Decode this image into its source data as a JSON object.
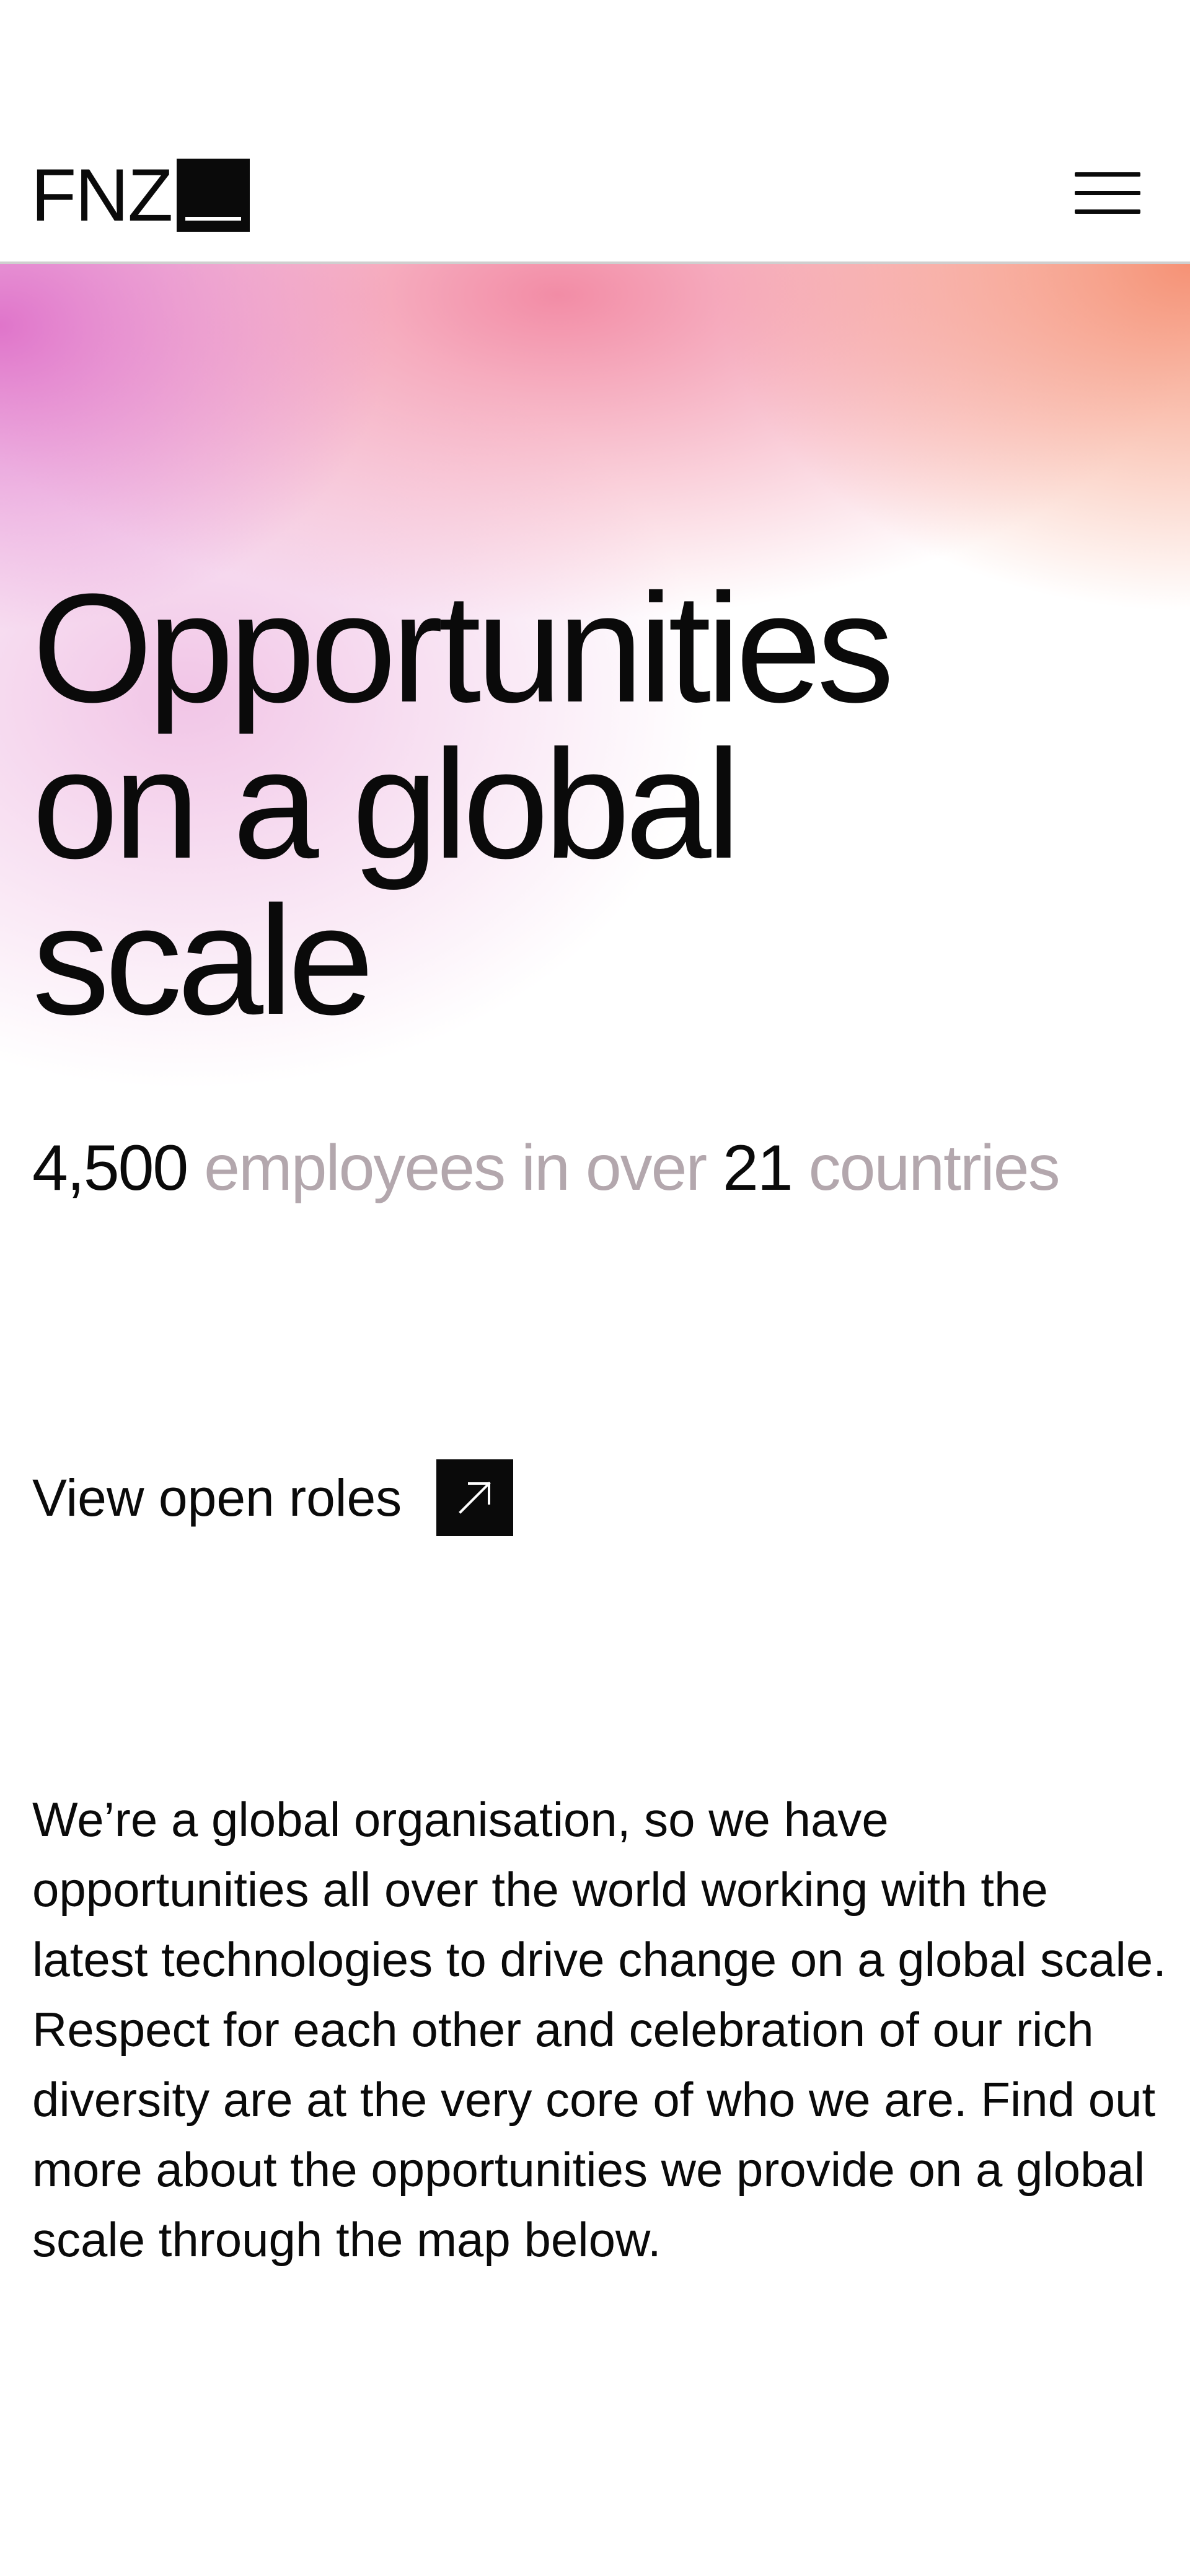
{
  "header": {
    "logo_text": "FNZ",
    "menu_icon": "hamburger-menu-icon"
  },
  "hero": {
    "headline_lines": [
      "Opportunities",
      "on a global",
      "scale"
    ],
    "stats": {
      "employees_count": "4,500",
      "employees_text": " employees in over ",
      "countries_count": "21",
      "countries_text": " countries"
    },
    "cta": {
      "label": "View open roles",
      "icon": "arrow-up-right-icon"
    }
  },
  "intro": {
    "paragraph": "We’re a global organisation, so we have opportunities all over the world working with the latest technologies to drive change on a global scale. Respect for each other and celebration of our rich diversity are at the very core of who we are. Find out more about the opportunities we provide on a global scale through the map below."
  },
  "colors": {
    "text": "#0a0a0a",
    "muted_text": "#b3a7ad",
    "gradient_pink": "#de6ec8",
    "gradient_coral": "#f58c6e",
    "background": "#ffffff"
  }
}
